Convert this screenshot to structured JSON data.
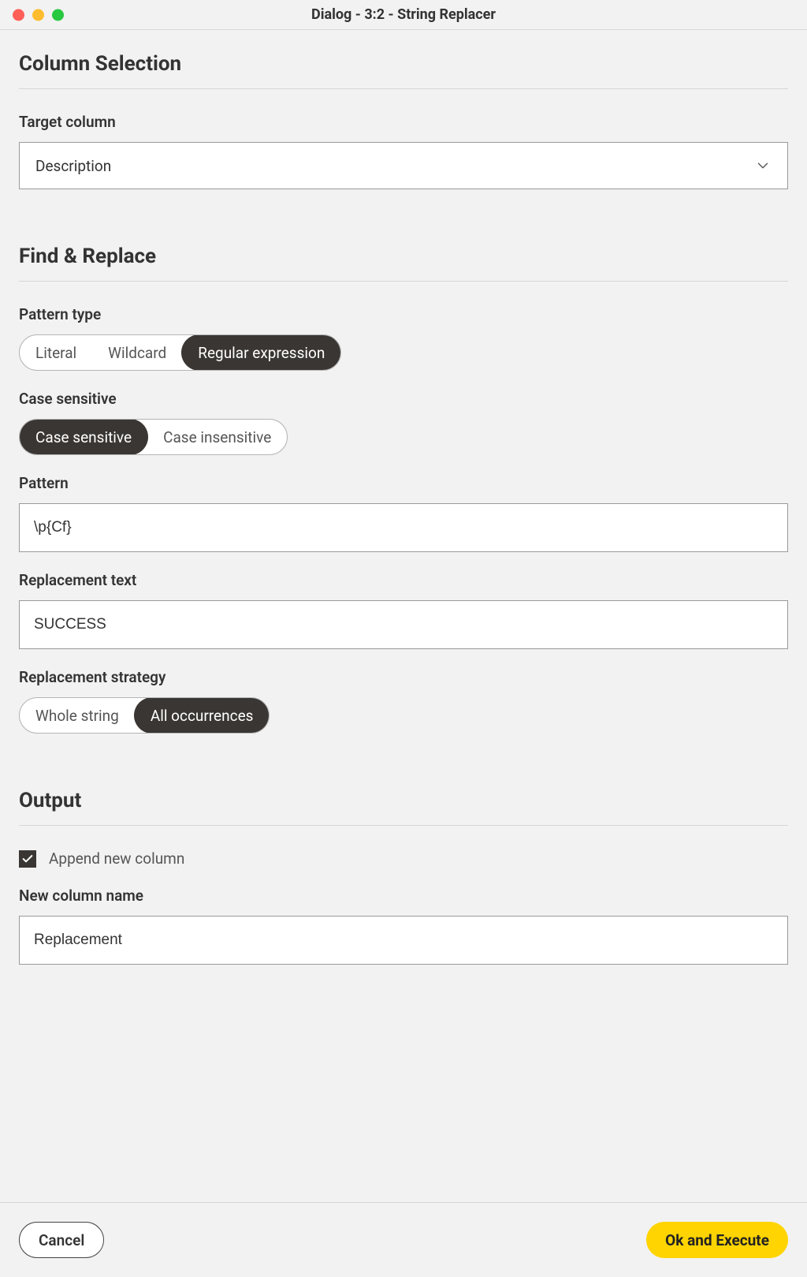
{
  "window": {
    "title": "Dialog - 3:2 - String Replacer"
  },
  "sections": {
    "column_selection": {
      "heading": "Column Selection",
      "target_column_label": "Target column",
      "target_column_value": "Description"
    },
    "find_replace": {
      "heading": "Find & Replace",
      "pattern_type_label": "Pattern type",
      "pattern_type_options": {
        "literal": "Literal",
        "wildcard": "Wildcard",
        "regex": "Regular expression"
      },
      "pattern_type_selected": "Regular expression",
      "case_label": "Case sensitive",
      "case_options": {
        "sensitive": "Case sensitive",
        "insensitive": "Case insensitive"
      },
      "case_selected": "Case sensitive",
      "pattern_label": "Pattern",
      "pattern_value": "\\p{Cf}",
      "replacement_text_label": "Replacement text",
      "replacement_text_value": "SUCCESS",
      "replacement_strategy_label": "Replacement strategy",
      "strategy_options": {
        "whole": "Whole string",
        "all": "All occurrences"
      },
      "strategy_selected": "All occurrences"
    },
    "output": {
      "heading": "Output",
      "append_label": "Append new column",
      "append_checked": true,
      "new_col_label": "New column name",
      "new_col_value": "Replacement"
    }
  },
  "footer": {
    "cancel": "Cancel",
    "ok": "Ok and Execute"
  }
}
